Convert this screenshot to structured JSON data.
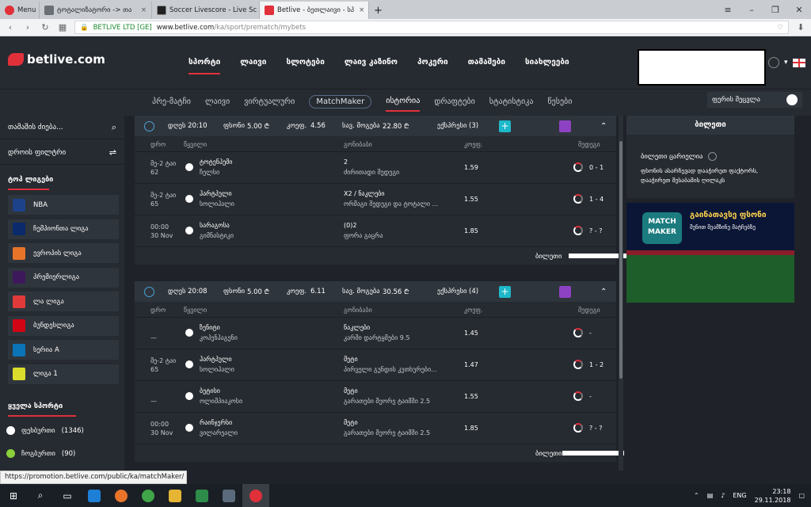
{
  "browser": {
    "tabs": [
      {
        "label": "Menu",
        "color": "#e0303a"
      },
      {
        "label": "ტოტალიზატორი -> თა",
        "color": "#6b6f76"
      },
      {
        "label": "Soccer Livescore - Live Sc",
        "color": "#222222"
      },
      {
        "label": "Betlive - ბეთლაივი - სპ",
        "color": "#e0303a"
      }
    ],
    "new_tab": "+",
    "url_org": "BETLIVE LTD [GE]",
    "url_domain": "www.betlive.com",
    "url_path": "/ka/sport/prematch/mybets"
  },
  "site": {
    "logo": "betlive.com",
    "main_nav": [
      "სპორტი",
      "ლაივი",
      "სლოტები",
      "ლაივ კაზინო",
      "პოკერი",
      "თამაშები",
      "სიახლეები"
    ],
    "sub_nav": [
      "პრე-მატჩი",
      "ლაივი",
      "ვირტუალური",
      "MatchMaker",
      "ისტორია",
      "დრაფტები",
      "სტატისტიკა",
      "წესები"
    ],
    "theme_button": "ფერის შეცვლა"
  },
  "left_sidebar": {
    "search_games": "თამაშის ძიება...",
    "time_filter": "დროის ფილტრი",
    "top_leagues_title": "ტოპ ლიგები",
    "leagues": [
      {
        "name": "NBA",
        "color": "#1d428a"
      },
      {
        "name": "ჩემპიონთა ლიგა",
        "color": "#0b2a6b"
      },
      {
        "name": "ევროპის ლიგა",
        "color": "#e8742a"
      },
      {
        "name": "პრემიერლიგა",
        "color": "#3d195b"
      },
      {
        "name": "ლა ლიგა",
        "color": "#e03a3a"
      },
      {
        "name": "ბუნდესლიგა",
        "color": "#d20515"
      },
      {
        "name": "სერია A",
        "color": "#0b74b8"
      },
      {
        "name": "ლიგა 1",
        "color": "#dadd2c"
      }
    ],
    "all_sports_title": "ყველა სპორტი",
    "sports": [
      {
        "name": "ფეხბურთი",
        "count": "(1346)",
        "color": "#ffffff"
      },
      {
        "name": "ჩოგბურთი",
        "count": "(90)",
        "color": "#8bd13a"
      }
    ]
  },
  "cols": {
    "time": "დრო",
    "pair": "წყვილი",
    "outcome": "გონიბაბი",
    "coef": "კოეფ.",
    "result": "შედეგი"
  },
  "bets": [
    {
      "date": "დღეს 20:10",
      "stake_label": "ფსონი",
      "stake": "5.00 ₾",
      "coef_label": "კოეფ.",
      "coef": "4.56",
      "win_label": "სავ. მოგება",
      "win": "22.80 ₾",
      "type": "ექსპრესი (3)",
      "matches": [
        {
          "t1": "მე-2 ტაი",
          "t2": "62",
          "h": "ტოტენჰემი",
          "a": "ჩელსი",
          "sel": "2",
          "mk": "ძირითადი შედეგი",
          "c": "1.59",
          "score": "0 - 1"
        },
        {
          "t1": "მე-2 ტაი",
          "t2": "65",
          "h": "ჰარტპული",
          "a": "სოლიჰალი",
          "sel": "X2 / ნაკლები",
          "mk": "ორმაგი შედეგი და ტოტალი ...",
          "c": "1.55",
          "score": "1 - 4"
        },
        {
          "t1": "00:00",
          "t2": "30 Nov",
          "h": "სარაგოსა",
          "a": "გიმნასტიკი",
          "sel": "(0)2",
          "mk": "ფორა გაცრა",
          "c": "1.85",
          "score": "? - ?"
        }
      ],
      "ticket_label": "ბილეთი"
    },
    {
      "date": "დღეს 20:08",
      "stake_label": "ფსონი",
      "stake": "5.00 ₾",
      "coef_label": "კოეფ.",
      "coef": "6.11",
      "win_label": "სავ. მოგება",
      "win": "30.56 ₾",
      "type": "ექსპრესი (4)",
      "matches": [
        {
          "t1": "",
          "t2": "—",
          "h": "ზენიტი",
          "a": "კოპენჰაგენი",
          "sel": "ნაკლები",
          "mk": "კარში დარტყმები 9.5",
          "c": "1.45",
          "score": "-"
        },
        {
          "t1": "მე-2 ტაი",
          "t2": "65",
          "h": "ჰარტპული",
          "a": "სოლიჰალი",
          "sel": "მეტი",
          "mk": "პირველი გუნდის კუთხურები...",
          "c": "1.47",
          "score": "1 - 2"
        },
        {
          "t1": "",
          "t2": "—",
          "h": "ბეტისი",
          "a": "ოლიმპიაკოსი",
          "sel": "მეტი",
          "mk": "გარათები მეორე ტაიმში 2.5",
          "c": "1.55",
          "score": "-"
        },
        {
          "t1": "00:00",
          "t2": "30 Nov",
          "h": "რაინჯერსი",
          "a": "ვილარეალი",
          "sel": "მეტი",
          "mk": "გარათები მეორე ტაიმში 2.5",
          "c": "1.85",
          "score": "? - ?"
        }
      ],
      "ticket_label": "ბილეთი"
    }
  ],
  "right": {
    "ticket_title": "ბილეთი",
    "ticket_heading": "ბილეთი ცარიელია",
    "ticket_desc": "ფსონის ასარჩევად დააჭირეთ ფაქტორს, დააჭირეთ შესაბამის ღილაკს",
    "promo_title": "გაინათავსე ფსონი",
    "promo_sub": "შენით შეამზინე მატჩებზე",
    "promo_logo": "MATCH MAKER"
  },
  "status_url": "https://promotion.betlive.com/public/ka/matchMaker/",
  "tray": {
    "lang": "ENG",
    "time": "23:18",
    "date": "29.11.2018"
  }
}
